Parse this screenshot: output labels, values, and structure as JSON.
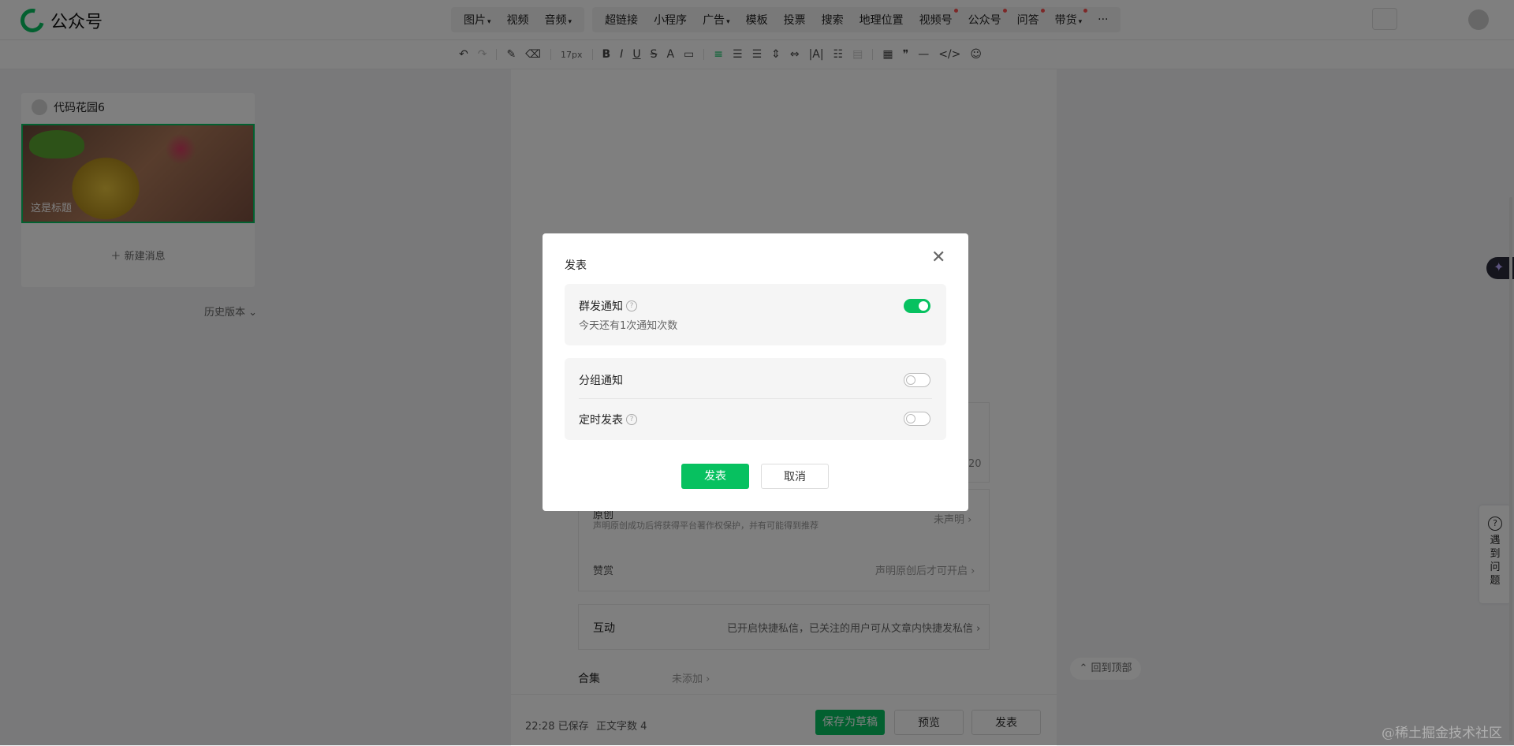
{
  "app": {
    "title": "公众号"
  },
  "insert_groups": [
    [
      {
        "label": "图片",
        "caret": true,
        "dot": false
      },
      {
        "label": "视频",
        "caret": false,
        "dot": false
      },
      {
        "label": "音频",
        "caret": true,
        "dot": false
      }
    ],
    [
      {
        "label": "超链接",
        "caret": false,
        "dot": false
      },
      {
        "label": "小程序",
        "caret": false,
        "dot": false
      },
      {
        "label": "广告",
        "caret": true,
        "dot": false
      },
      {
        "label": "模板",
        "caret": false,
        "dot": false
      },
      {
        "label": "投票",
        "caret": false,
        "dot": false
      },
      {
        "label": "搜索",
        "caret": false,
        "dot": false
      },
      {
        "label": "地理位置",
        "caret": false,
        "dot": false
      },
      {
        "label": "视频号",
        "caret": false,
        "dot": true
      },
      {
        "label": "公众号",
        "caret": false,
        "dot": true
      },
      {
        "label": "问答",
        "caret": false,
        "dot": true
      },
      {
        "label": "带货",
        "caret": true,
        "dot": true
      },
      {
        "label": "···",
        "caret": false,
        "dot": false
      }
    ]
  ],
  "format_toolbar": {
    "font_size": "17px"
  },
  "left_panel": {
    "account_name": "代码花园6",
    "cover_title": "这是标题",
    "new_message": "新建消息",
    "history": "历史版本"
  },
  "editor": {
    "count_hint": "20",
    "original_label": "原创",
    "original_desc": "声明原创成功后将获得平台著作权保护，并有可能得到推荐",
    "original_status": "未声明 ›",
    "reward_label": "赞赏",
    "reward_status": "声明原创后才可开启 ›",
    "interaction_label": "互动",
    "interaction_status": "已开启快捷私信，已关注的用户可从文章内快捷发私信 ›",
    "collection_label": "合集",
    "collection_status": "未添加 ›"
  },
  "bottom_bar": {
    "save_time": "22:28 已保存",
    "word_count": "正文字数 4",
    "save_draft": "保存为草稿",
    "preview": "预览",
    "publish": "发表"
  },
  "side": {
    "back_to_top": "回到顶部",
    "help_label": "遇到问题"
  },
  "watermark": "@稀土掘金技术社区",
  "modal": {
    "title": "发表",
    "mass_notify_label": "群发通知",
    "mass_notify_on": true,
    "mass_notify_sub": "今天还有1次通知次数",
    "group_notify_label": "分组通知",
    "group_notify_on": false,
    "schedule_label": "定时发表",
    "schedule_on": false,
    "publish_button": "发表",
    "cancel_button": "取消"
  },
  "colors": {
    "accent": "#07c160",
    "overlay": "rgba(0,0,0,0.5)",
    "badge": "#fa5151"
  }
}
